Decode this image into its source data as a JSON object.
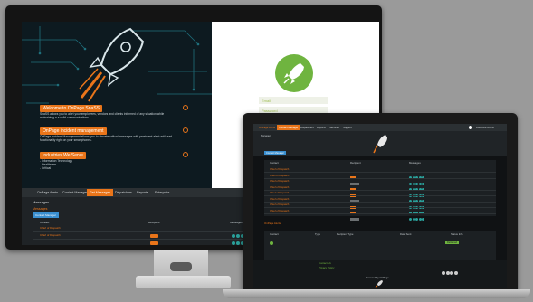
{
  "monitor": {
    "hero": {
      "items": [
        {
          "title": "Welcome to OnPage SnaSS",
          "text": "SnaSS allows you to alert your employees, vendors and clients informed of any situation while mainaining a a solid communications."
        },
        {
          "title": "OnPage incident management",
          "text": "OnPage Incident Management allows you to elevate critical messages with persistent alert until read functionality right on your smartphones."
        },
        {
          "title": "Industries We Serve",
          "text": "- Information Technology\n- Healthcare\n- Critical"
        }
      ]
    },
    "login": {
      "email_placeholder": "Email",
      "password_placeholder": "Password"
    },
    "nav": {
      "tabs": [
        "OnPage Alerts",
        "Contact Manager",
        "Get Messages",
        "Dispatchers",
        "Reports",
        "Enterprise"
      ],
      "active_index": 2
    },
    "content": {
      "title": "Messages",
      "section_label": "Messages",
      "button_label": "Contact Manager",
      "table_headers": [
        "Contact",
        "Recipient",
        "Messages"
      ],
      "rows": [
        {
          "name": "Chief of Dispatch"
        },
        {
          "name": "Chief of Dispatch"
        }
      ]
    }
  },
  "laptop": {
    "topbar": {
      "brand": "OnPage Alerts",
      "tabs": [
        "Contact Manager",
        "Dispatchers",
        "Reports",
        "Services",
        "Support"
      ],
      "user": "Welcome Admin"
    },
    "page_title": "Manager",
    "badge": "Contact Manager",
    "table": {
      "headers": [
        "Contact",
        "Recipient",
        "Messages"
      ],
      "rows": [
        "Chief of Dispatch",
        "Chief of Dispatch",
        "Chief of Dispatch",
        "Chief of Dispatch",
        "Chief of Dispatch",
        "Chief of Dispatch",
        "Chief of Dispatch",
        "Chief of Dispatch"
      ]
    },
    "section2": {
      "title": "OnPage Alerts",
      "headers": [
        "Contact",
        "Type",
        "Recipient Type",
        "Date Sent",
        "Status Info"
      ],
      "row_status": "Delivered"
    },
    "footer": {
      "links": [
        "Contact Us",
        "Privacy Policy"
      ],
      "powered": "Powered by OnPage"
    }
  },
  "colors": {
    "accent": "#e9751a",
    "teal": "#2aa09a",
    "green": "#6fb43f"
  }
}
